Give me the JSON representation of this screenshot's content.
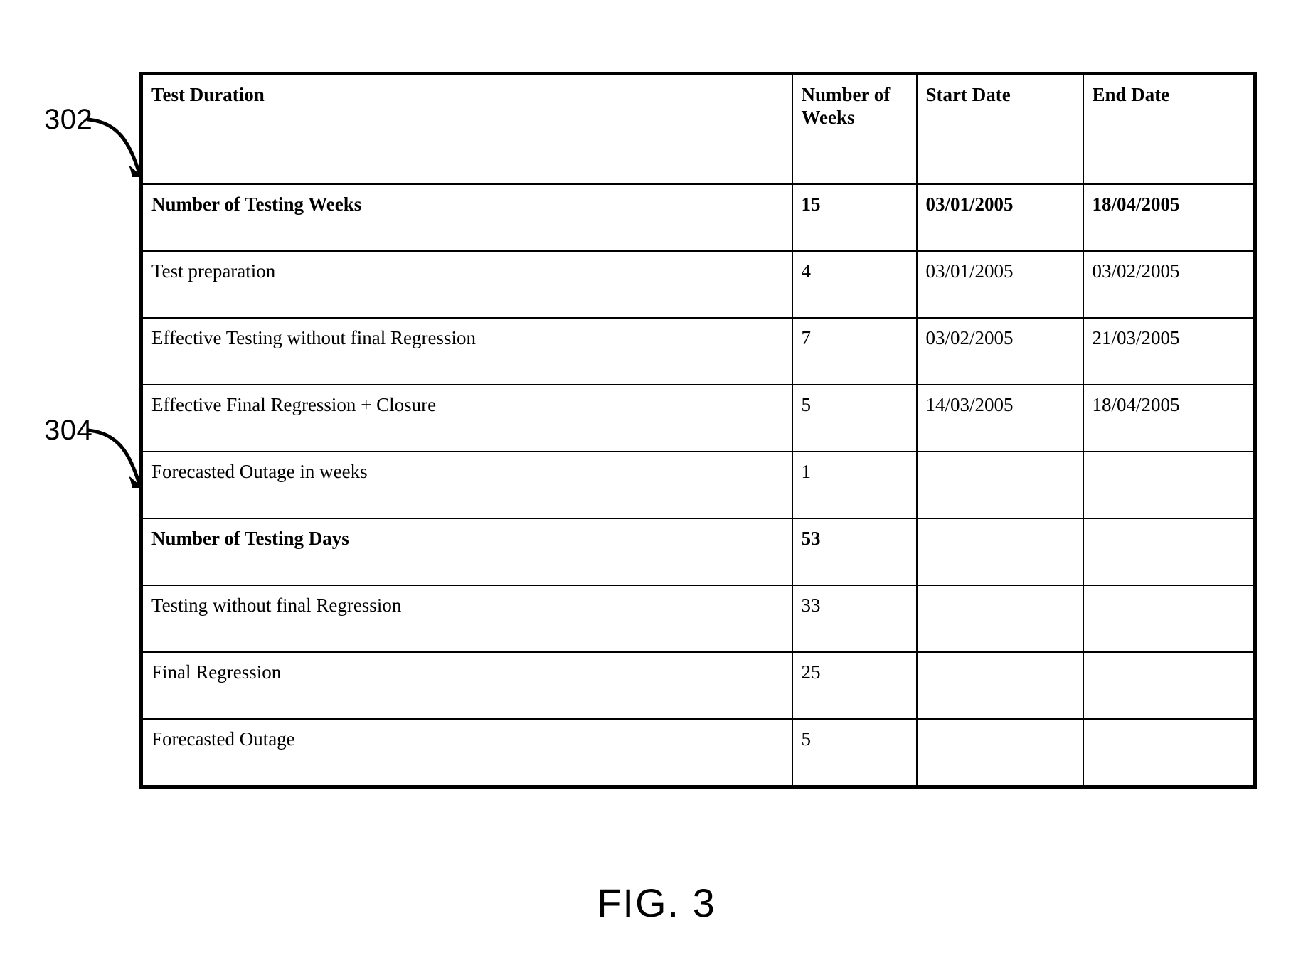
{
  "figure": {
    "caption": "FIG. 3",
    "callouts": [
      {
        "id": "302",
        "label": "302"
      },
      {
        "id": "304",
        "label": "304"
      }
    ]
  },
  "table": {
    "columns": [
      {
        "key": "description",
        "label": "Test Duration"
      },
      {
        "key": "weeks",
        "label": "Number of\nWeeks",
        "label_line1": "Number of",
        "label_line2": "Weeks"
      },
      {
        "key": "start_date",
        "label": "Start Date"
      },
      {
        "key": "end_date",
        "label": "End Date"
      }
    ],
    "rows": [
      {
        "description": "Number of Testing Weeks",
        "weeks": "15",
        "start_date": "03/01/2005",
        "end_date": "18/04/2005",
        "bold": true
      },
      {
        "description": "Test preparation",
        "weeks": "4",
        "start_date": "03/01/2005",
        "end_date": "03/02/2005",
        "bold": false
      },
      {
        "description": "Effective Testing without final Regression",
        "weeks": "7",
        "start_date": "03/02/2005",
        "end_date": "21/03/2005",
        "bold": false
      },
      {
        "description": "Effective Final Regression + Closure",
        "weeks": "5",
        "start_date": "14/03/2005",
        "end_date": "18/04/2005",
        "bold": false
      },
      {
        "description": "Forecasted Outage in weeks",
        "weeks": "1",
        "start_date": "",
        "end_date": "",
        "bold": false
      },
      {
        "description": "Number of Testing Days",
        "weeks": "53",
        "start_date": "",
        "end_date": "",
        "bold": true
      },
      {
        "description": "Testing without final Regression",
        "weeks": "33",
        "start_date": "",
        "end_date": "",
        "bold": false
      },
      {
        "description": "Final Regression",
        "weeks": "25",
        "start_date": "",
        "end_date": "",
        "bold": false
      },
      {
        "description": "Forecasted Outage",
        "weeks": "5",
        "start_date": "",
        "end_date": "",
        "bold": false
      }
    ]
  }
}
